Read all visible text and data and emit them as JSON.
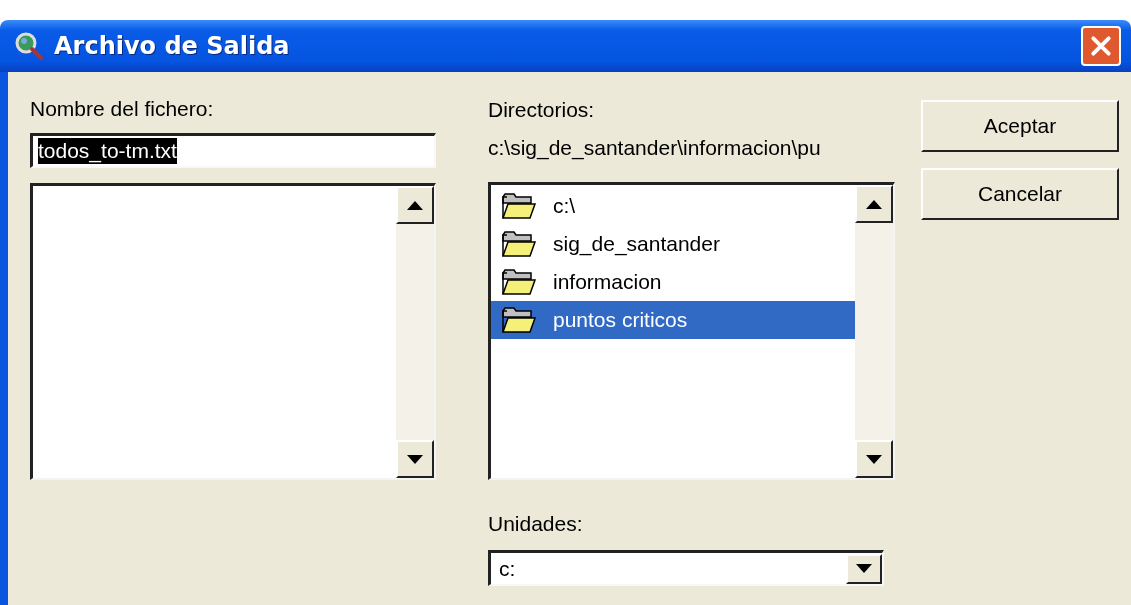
{
  "window": {
    "title": "Archivo de Salida"
  },
  "file_name": {
    "label": "Nombre del fichero:",
    "value": "todos_to-tm.txt",
    "text_selected": true
  },
  "directories": {
    "label": "Directorios:",
    "path": "c:\\sig_de_santander\\informacion\\pu",
    "items": [
      {
        "name": "c:\\",
        "selected": false
      },
      {
        "name": "sig_de_santander",
        "selected": false
      },
      {
        "name": "informacion",
        "selected": false
      },
      {
        "name": "puntos criticos",
        "selected": true
      }
    ]
  },
  "drives": {
    "label": "Unidades:",
    "value": "c:"
  },
  "buttons": [
    "Aceptar",
    "Cancelar"
  ]
}
